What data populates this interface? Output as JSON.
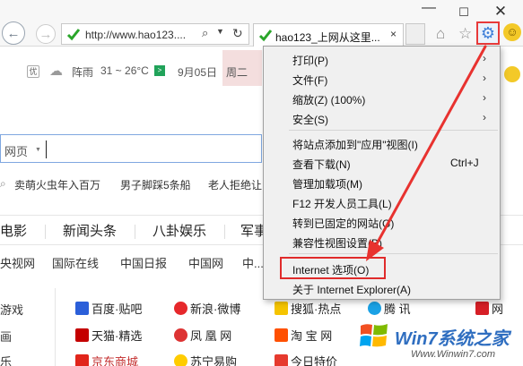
{
  "window": {
    "min": "—",
    "max": "☐",
    "close": "✕"
  },
  "address_bar": {
    "url": "http://www.hao123....",
    "logo_text": "hao"
  },
  "tab": {
    "title": "hao123_上网从这里...",
    "close": "×"
  },
  "weather": {
    "badge": "优",
    "condition": "阵雨",
    "temp": "31 ~ 26°C",
    "green": ">",
    "date": "9月05日",
    "weekday": "周二"
  },
  "search": {
    "label": "网页"
  },
  "hot_searches": [
    "卖萌火虫年入百万",
    "男子脚踩5条船",
    "老人拒绝让"
  ],
  "categories": [
    "电影",
    "新闻头条",
    "八卦娱乐",
    "军事"
  ],
  "media_links": [
    "央视网",
    "国际在线",
    "中国日报",
    "中国网",
    "中..."
  ],
  "side_items": [
    "游戏",
    "画",
    "乐"
  ],
  "sites": [
    {
      "label": "百度·贴吧"
    },
    {
      "label": "新浪·微博"
    },
    {
      "label": "搜狐·热点"
    },
    {
      "label": "腾 讯"
    },
    {
      "label": "网"
    },
    {
      "label": "天猫·精选"
    },
    {
      "label": "凤 凰 网"
    },
    {
      "label": "淘 宝 网"
    },
    {
      "label": "京东商城"
    },
    {
      "label": "苏宁易购"
    },
    {
      "label": "今日特价"
    }
  ],
  "menu": {
    "items": [
      {
        "label": "打印(P)",
        "arrow": "›"
      },
      {
        "label": "文件(F)",
        "arrow": "›"
      },
      {
        "label": "缩放(Z) (100%)",
        "arrow": "›"
      },
      {
        "label": "安全(S)",
        "arrow": "›"
      },
      {
        "label": "将站点添加到\"应用\"视图(I)"
      },
      {
        "label": "查看下载(N)",
        "shortcut": "Ctrl+J"
      },
      {
        "label": "管理加载项(M)"
      },
      {
        "label": "F12 开发人员工具(L)"
      },
      {
        "label": "转到已固定的网站(G)"
      },
      {
        "label": "兼容性视图设置(B)"
      },
      {
        "label": "Internet 选项(O)"
      },
      {
        "label": "关于 Internet Explorer(A)"
      }
    ]
  },
  "watermark": {
    "brand": "Win7系统之家",
    "url": "Www.Winwin7.com"
  },
  "colors": {
    "highlight": "#e02b2b",
    "gear": "#3b7dd8",
    "link_blue": "#2f6ec0"
  }
}
